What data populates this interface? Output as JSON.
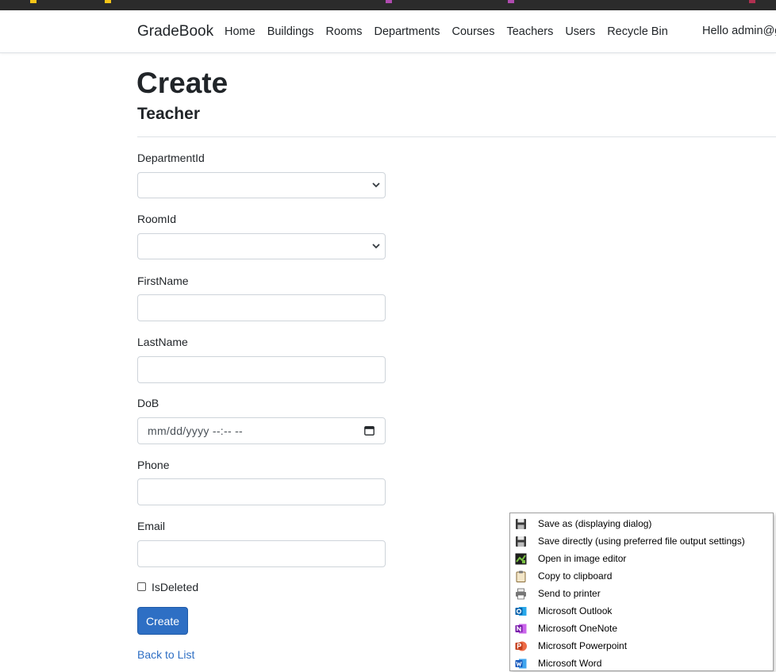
{
  "navbar": {
    "brand": "GradeBook",
    "links": [
      "Home",
      "Buildings",
      "Rooms",
      "Departments",
      "Courses",
      "Teachers",
      "Users",
      "Recycle Bin"
    ],
    "greeting": "Hello admin@g"
  },
  "page": {
    "title": "Create",
    "subtitle": "Teacher"
  },
  "form": {
    "department_label": "DepartmentId",
    "room_label": "RoomId",
    "firstname_label": "FirstName",
    "lastname_label": "LastName",
    "dob_label": "DoB",
    "dob_placeholder": "mm/dd/yyyy --:-- --",
    "phone_label": "Phone",
    "email_label": "Email",
    "isdeleted_label": "IsDeleted",
    "submit_label": "Create",
    "back_link": "Back to List"
  },
  "colors": {
    "primary": "#2e6fc4",
    "border": "#ced4da"
  },
  "context_menu": {
    "items": [
      {
        "label": "Save as (displaying dialog)",
        "icon": "floppy-icon"
      },
      {
        "label": "Save directly (using preferred file output settings)",
        "icon": "floppy-icon"
      },
      {
        "label": "Open in image editor",
        "icon": "image-editor-icon"
      },
      {
        "label": "Copy to clipboard",
        "icon": "clipboard-icon"
      },
      {
        "label": "Send to printer",
        "icon": "printer-icon"
      },
      {
        "label": "Microsoft Outlook",
        "icon": "outlook-icon"
      },
      {
        "label": "Microsoft OneNote",
        "icon": "onenote-icon"
      },
      {
        "label": "Microsoft Powerpoint",
        "icon": "powerpoint-icon"
      },
      {
        "label": "Microsoft Word",
        "icon": "word-icon"
      }
    ]
  }
}
